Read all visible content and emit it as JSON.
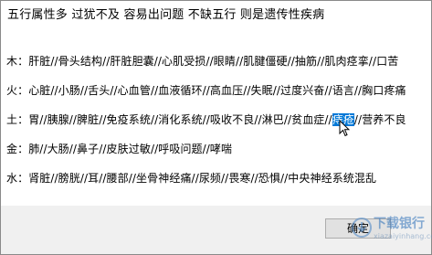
{
  "dialog": {
    "title": "五行属性多 过犹不及 容易出问题    不缺五行 则是遗传性疾病",
    "lines": [
      {
        "element": "木",
        "text": "木：肝脏//骨头结构//肝脏胆囊//心肌受损//眼睛//肌腱僵硬//抽筋//肌肉痉挛//口苦"
      },
      {
        "element": "火",
        "text": "火：心脏//小肠//舌头//心血管//血液循环//高血压//失眠//过度兴奋//语言//胸口疼痛"
      },
      {
        "element": "土",
        "text_before": "土：胃//胰腺//脾脏//免疫系统//消化系统//吸收不良//淋巴//贫血症//",
        "text_highlight": "痔疮",
        "text_after": "//营养不良"
      },
      {
        "element": "金",
        "text": "金：肺//大肠//鼻子//皮肤过敏//呼吸问题//哮喘"
      },
      {
        "element": "水",
        "text": "水：肾脏//膀胱//耳//腰部//坐骨神经痛//尿频//畏寒//恐惧//中央神经系统混乱"
      }
    ],
    "ok_button": "确定"
  },
  "watermark": {
    "text": "下载银行",
    "subtext": "xiazaiyinhang.com"
  },
  "colors": {
    "highlight": "#0078d7",
    "background": "#ffffff",
    "button": "#e1e1e1"
  }
}
